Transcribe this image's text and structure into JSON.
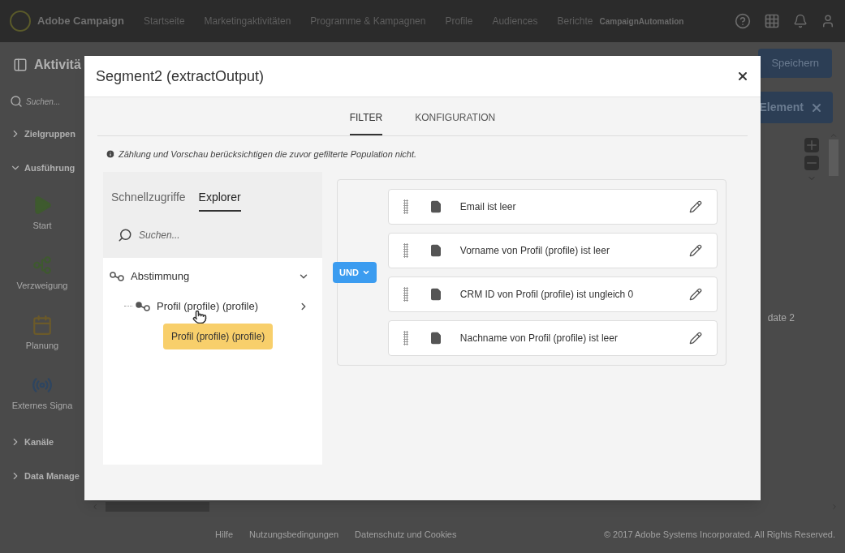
{
  "nav": {
    "brand": "Adobe Campaign",
    "items": [
      "Startseite",
      "Marketingaktivitäten",
      "Programme & Kampagnen",
      "Profile",
      "Audiences",
      "Berichte"
    ],
    "account": "CampaignAutomation"
  },
  "background": {
    "title": "Aktivitä",
    "save_button": "Speichern",
    "element_button": "Element",
    "sidebar": {
      "search_placeholder": "Suchen...",
      "groups": [
        {
          "label": "Zielgruppen",
          "expanded": false
        },
        {
          "label": "Ausführung",
          "expanded": true,
          "items": [
            {
              "label": "Start",
              "kind": "play"
            },
            {
              "label": "Verzweigung",
              "kind": "branch"
            },
            {
              "label": "Planung",
              "kind": "calendar"
            },
            {
              "label": "Externes Signa",
              "kind": "signal"
            }
          ]
        },
        {
          "label": "Kanäle",
          "expanded": false
        },
        {
          "label": "Data Manage",
          "expanded": false
        }
      ]
    },
    "canvas_label": "date 2",
    "footer": {
      "links": [
        "Hilfe",
        "Nutzungsbedingungen",
        "Datenschutz und Cookies"
      ],
      "copyright": "© 2017 Adobe Systems Incorporated. All Rights Reserved."
    }
  },
  "dialog": {
    "title": "Segment2 (extractOutput)",
    "tabs": [
      {
        "label": "FILTER",
        "selected": true
      },
      {
        "label": "KONFIGURATION",
        "selected": false
      }
    ],
    "notice": "Zählung und Vorschau berücksichtigen die zuvor gefilterte Population nicht.",
    "explorer": {
      "tabs": [
        {
          "label": "Schnellzugriffe",
          "selected": false
        },
        {
          "label": "Explorer",
          "selected": true
        }
      ],
      "search_placeholder": "Suchen...",
      "tree": [
        {
          "label": "Abstimmung",
          "expanded": true,
          "children": [
            {
              "label": "Profil (profile) (profile)",
              "expanded": false
            }
          ]
        }
      ],
      "tooltip": "Profil (profile) (profile)"
    },
    "operator": "UND",
    "conditions": [
      {
        "label": "Email ist leer"
      },
      {
        "label": "Vorname von Profil (profile) ist leer"
      },
      {
        "label": "CRM ID von Profil (profile) ist ungleich 0"
      },
      {
        "label": "Nachname von Profil (profile) ist leer"
      }
    ]
  }
}
